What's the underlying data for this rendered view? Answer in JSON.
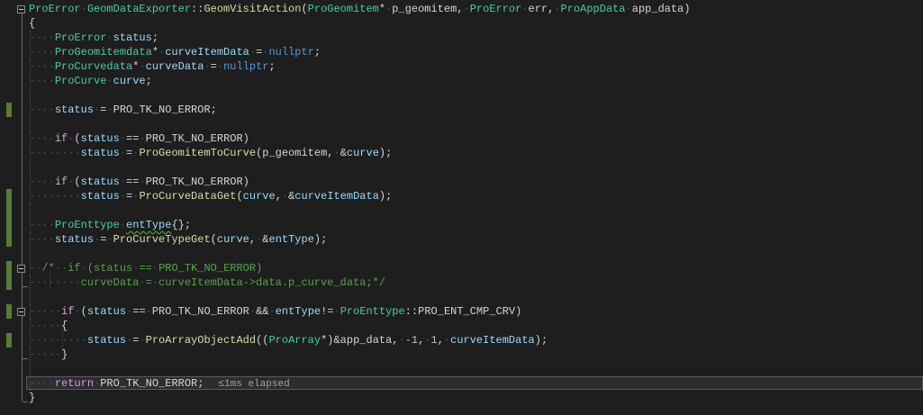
{
  "editor": {
    "perf_tip": "≤1ms elapsed",
    "colors": {
      "background": "#1e1e1e",
      "type": "#4EC9B0",
      "keyword": "#569CD6",
      "control_keyword": "#D8A0DF",
      "function": "#DCDCAA",
      "local_variable": "#9CDCFE",
      "plain_text": "#D6D6D6",
      "number": "#B5CEA8",
      "comment": "#57A64A",
      "whitespace_glyph": "#3E5B55",
      "change_bar": "#5b7a3a",
      "line_highlight_bg": "#2d2d31",
      "line_highlight_border": "#5a5a5c",
      "squiggle": "#3ec13e"
    },
    "lines": [
      {
        "fold": true,
        "tokens": [
          [
            "t",
            "ProError"
          ],
          [
            "p",
            " "
          ],
          [
            "t",
            "GeomDataExporter"
          ],
          [
            "p",
            "::"
          ],
          [
            "f",
            "GeomVisitAction"
          ],
          [
            "p",
            "("
          ],
          [
            "t",
            "ProGeomitem"
          ],
          [
            "p",
            "* p_geomitem, "
          ],
          [
            "t",
            "ProError"
          ],
          [
            "p",
            " err, "
          ],
          [
            "t",
            "ProAppData"
          ],
          [
            "p",
            " app_data)"
          ]
        ]
      },
      {
        "tokens": [
          [
            "p",
            "{"
          ]
        ]
      },
      {
        "guides": [
          0
        ],
        "tokens": [
          [
            "p",
            "    "
          ],
          [
            "t",
            "ProError"
          ],
          [
            "p",
            " "
          ],
          [
            "v",
            "status"
          ],
          [
            "p",
            ";"
          ]
        ]
      },
      {
        "guides": [
          0
        ],
        "tokens": [
          [
            "p",
            "    "
          ],
          [
            "t",
            "ProGeomitemdata"
          ],
          [
            "p",
            "* "
          ],
          [
            "v",
            "curveItemData"
          ],
          [
            "p",
            " = "
          ],
          [
            "k",
            "nullptr"
          ],
          [
            "p",
            ";"
          ]
        ]
      },
      {
        "guides": [
          0
        ],
        "tokens": [
          [
            "p",
            "    "
          ],
          [
            "t",
            "ProCurvedata"
          ],
          [
            "p",
            "* "
          ],
          [
            "v",
            "curveData"
          ],
          [
            "p",
            " = "
          ],
          [
            "k",
            "nullptr"
          ],
          [
            "p",
            ";"
          ]
        ]
      },
      {
        "guides": [
          0
        ],
        "tokens": [
          [
            "p",
            "    "
          ],
          [
            "t",
            "ProCurve"
          ],
          [
            "p",
            " "
          ],
          [
            "v",
            "curve"
          ],
          [
            "p",
            ";"
          ]
        ]
      },
      {
        "guides": [
          0
        ],
        "tokens": []
      },
      {
        "guides": [
          0
        ],
        "bar": true,
        "tokens": [
          [
            "p",
            "    "
          ],
          [
            "v",
            "status"
          ],
          [
            "p",
            " = PRO_TK_NO_ERROR;"
          ]
        ]
      },
      {
        "guides": [
          0
        ],
        "tokens": []
      },
      {
        "guides": [
          0
        ],
        "tokens": [
          [
            "p",
            "    "
          ],
          [
            "c",
            "if"
          ],
          [
            "p",
            " ("
          ],
          [
            "v",
            "status"
          ],
          [
            "p",
            " == PRO_TK_NO_ERROR)"
          ]
        ]
      },
      {
        "guides": [
          0
        ],
        "tokens": [
          [
            "p",
            "        "
          ],
          [
            "v",
            "status"
          ],
          [
            "p",
            " = "
          ],
          [
            "f",
            "ProGeomitemToCurve"
          ],
          [
            "p",
            "(p_geomitem, &"
          ],
          [
            "v",
            "curve"
          ],
          [
            "p",
            ");"
          ]
        ]
      },
      {
        "guides": [
          0
        ],
        "tokens": []
      },
      {
        "guides": [
          0
        ],
        "tokens": [
          [
            "p",
            "    "
          ],
          [
            "c",
            "if"
          ],
          [
            "p",
            " ("
          ],
          [
            "v",
            "status"
          ],
          [
            "p",
            " == PRO_TK_NO_ERROR)"
          ]
        ]
      },
      {
        "guides": [
          0
        ],
        "bar": true,
        "tokens": [
          [
            "p",
            "        "
          ],
          [
            "v",
            "status"
          ],
          [
            "p",
            " = "
          ],
          [
            "f",
            "ProCurveDataGet"
          ],
          [
            "p",
            "("
          ],
          [
            "v",
            "curve"
          ],
          [
            "p",
            ", &"
          ],
          [
            "v",
            "curveItemData"
          ],
          [
            "p",
            ");"
          ]
        ]
      },
      {
        "guides": [
          0
        ],
        "bar": true,
        "tokens": []
      },
      {
        "guides": [
          0
        ],
        "bar": true,
        "tokens": [
          [
            "p",
            "    "
          ],
          [
            "t",
            "ProEnttype"
          ],
          [
            "p",
            " "
          ],
          [
            "u",
            "entType"
          ],
          [
            "p",
            "{};"
          ]
        ]
      },
      {
        "guides": [
          0
        ],
        "bar": true,
        "tokens": [
          [
            "p",
            "    "
          ],
          [
            "v",
            "status"
          ],
          [
            "p",
            " = "
          ],
          [
            "f",
            "ProCurveTypeGet"
          ],
          [
            "p",
            "("
          ],
          [
            "v",
            "curve"
          ],
          [
            "p",
            ", &"
          ],
          [
            "v",
            "entType"
          ],
          [
            "p",
            ");"
          ]
        ]
      },
      {
        "guides": [
          0
        ],
        "tokens": []
      },
      {
        "guides": [
          0
        ],
        "bar": true,
        "fold": true,
        "tokens": [
          [
            "m",
            "  /*  if (status == PRO_TK_NO_ERROR)"
          ]
        ]
      },
      {
        "guides": [
          0,
          3
        ],
        "bar": true,
        "foldEnd": true,
        "tokens": [
          [
            "m",
            "        curveData = curveItemData->data.p_curve_data;*/"
          ]
        ]
      },
      {
        "guides": [
          0
        ],
        "tokens": []
      },
      {
        "guides": [
          0
        ],
        "bar": true,
        "fold": true,
        "tokens": [
          [
            "p",
            "     "
          ],
          [
            "c",
            "if"
          ],
          [
            "p",
            " ("
          ],
          [
            "v",
            "status"
          ],
          [
            "p",
            " == PRO_TK_NO_ERROR && "
          ],
          [
            "v",
            "entType"
          ],
          [
            "p",
            "!= "
          ],
          [
            "t",
            "ProEnttype"
          ],
          [
            "p",
            "::PRO_ENT_CMP_CRV)"
          ]
        ]
      },
      {
        "guides": [
          0
        ],
        "tokens": [
          [
            "p",
            "     {"
          ]
        ]
      },
      {
        "guides": [
          0,
          5
        ],
        "bar": true,
        "tokens": [
          [
            "p",
            "         "
          ],
          [
            "v",
            "status"
          ],
          [
            "p",
            " = "
          ],
          [
            "f",
            "ProArrayObjectAdd"
          ],
          [
            "p",
            "(("
          ],
          [
            "t",
            "ProArray"
          ],
          [
            "p",
            "*)&app_data, "
          ],
          [
            "n",
            "-1"
          ],
          [
            "p",
            ", "
          ],
          [
            "n",
            "1"
          ],
          [
            "p",
            ", "
          ],
          [
            "v",
            "curveItemData"
          ],
          [
            "p",
            ");"
          ]
        ]
      },
      {
        "guides": [
          0
        ],
        "foldEnd": true,
        "tokens": [
          [
            "p",
            "     }"
          ]
        ]
      },
      {
        "guides": [
          0
        ],
        "tokens": []
      },
      {
        "guides": [
          0
        ],
        "hl": true,
        "tip": "≤1ms elapsed",
        "tokens": [
          [
            "p",
            "    "
          ],
          [
            "c",
            "return"
          ],
          [
            "p",
            " PRO_TK_NO_ERROR;"
          ]
        ]
      },
      {
        "foldEnd": true,
        "tokens": [
          [
            "p",
            "}"
          ]
        ]
      }
    ]
  }
}
